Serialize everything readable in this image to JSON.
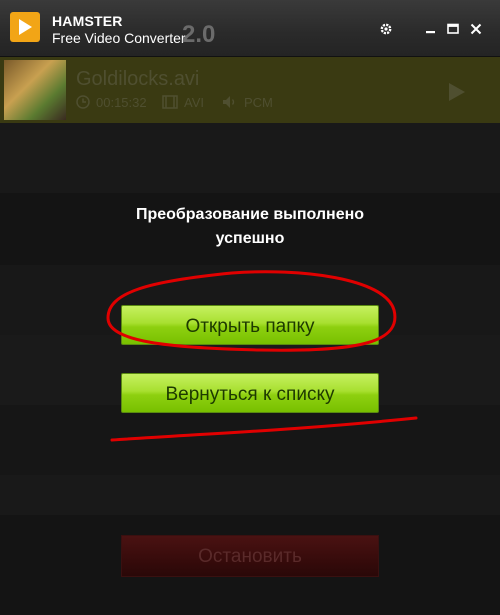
{
  "app": {
    "name": "HAMSTER",
    "subtitle": "Free Video Converter",
    "version": "2.0",
    "accent_color": "#f2a516"
  },
  "window_controls": [
    "gear-icon",
    "minimize-icon",
    "maximize-icon",
    "close-icon"
  ],
  "file": {
    "name": "Goldilocks.avi",
    "duration": "00:15:32",
    "format": "AVI",
    "audio": "PCM"
  },
  "dialog": {
    "message": "Преобразование выполнено успешно",
    "open_folder_label": "Открыть папку",
    "back_to_list_label": "Вернуться к списку"
  },
  "footer": {
    "stop_label": "Остановить"
  },
  "colors": {
    "button_green": "#8ed010",
    "annotation_red": "#e00000"
  }
}
